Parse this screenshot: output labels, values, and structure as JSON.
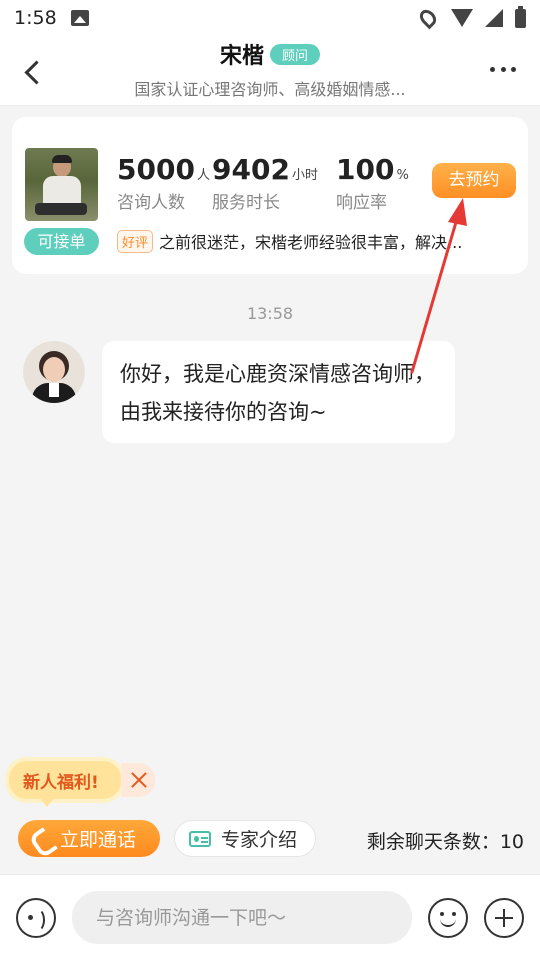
{
  "status_bar": {
    "time": "1:58"
  },
  "header": {
    "title": "宋楷",
    "title_tag": "顾问",
    "subtitle": "国家认证心理咨询师、高级婚姻情感..."
  },
  "counselor_card": {
    "availability": "可接单",
    "stats": [
      {
        "value": "5000",
        "unit": "人",
        "label": "咨询人数"
      },
      {
        "value": "9402",
        "unit": "小时",
        "label": "服务时长"
      },
      {
        "value": "100",
        "unit": "%",
        "label": "响应率"
      }
    ],
    "book_button": "去预约",
    "review_tag": "好评",
    "review_text": "之前很迷茫，宋楷老师经验很丰富，解决..."
  },
  "chat": {
    "timestamp": "13:58",
    "messages": [
      {
        "sender": "counselor",
        "text": "你好，我是心鹿资深情感咨询师，由我来接待你的咨询~"
      }
    ]
  },
  "welfare_banner": {
    "label": "新人福利!"
  },
  "actions": {
    "call_button": "立即通话",
    "intro_button": "专家介绍",
    "remaining_chats": "剩余聊天条数：10"
  },
  "input_bar": {
    "placeholder": "与咨询师沟通一下吧～"
  },
  "colors": {
    "accent_orange": "#ff8f24",
    "accent_teal": "#5fcfbd",
    "annotation_red": "#e53935"
  },
  "icons": [
    "back-icon",
    "more-icon",
    "phone-icon",
    "id-card-icon",
    "voice-icon",
    "emoji-icon",
    "plus-icon",
    "close-icon"
  ]
}
